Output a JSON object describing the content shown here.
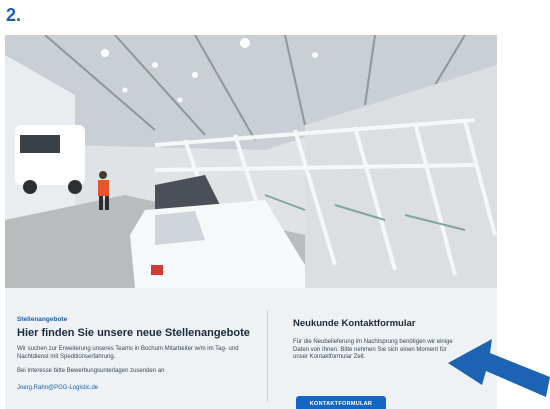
{
  "step_label": "2.",
  "jobs": {
    "eyebrow": "Stellenangebote",
    "title": "Hier finden Sie unsere neue Stellenangebote",
    "text1": "Wir suchen zur Erweiterung unseres Teams in Bochum Mitarbeiter w/m im Tag- und Nachtdienst mit Speditionserfahrung.",
    "text2": "Bei Interesse bitte Bewerbungsunterlagen zusenden an",
    "email": "Joerg.Rahn@PGG-Logistic.de"
  },
  "contact": {
    "title": "Neukunde Kontaktformular",
    "text": "Für die Neubelieferung im Nachtsprung benötigen wir einige Daten von Ihnen. Bitte nehmen Sie sich einen Moment für unser Kontaktformular Zeit.",
    "button_label": "KONTAKTFORMULAR"
  },
  "colors": {
    "accent": "#1a5fa8",
    "button": "#1466c2",
    "arrow": "#1c63b4",
    "panel_bg": "#eef2f4"
  },
  "icons": {
    "annotation": "arrow-pointing-left-icon"
  }
}
